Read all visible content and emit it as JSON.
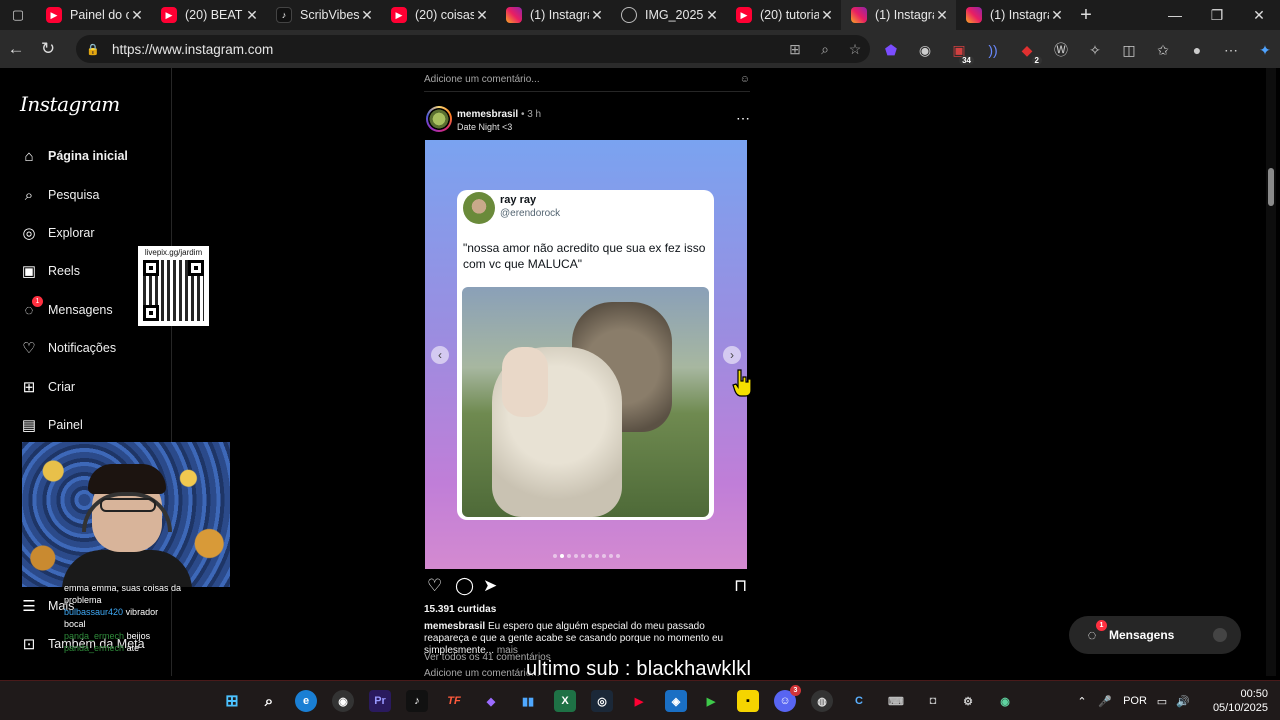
{
  "browser": {
    "tabs": [
      {
        "title": "Painel do ca",
        "favicon": "youtube-icon",
        "active": false
      },
      {
        "title": "(20) BEAT N",
        "favicon": "youtube-icon",
        "active": false
      },
      {
        "title": "ScribVibes (",
        "favicon": "tiktok-icon",
        "active": false
      },
      {
        "title": "(20) coisas c",
        "favicon": "youtube-icon",
        "active": false
      },
      {
        "title": "(1) Instagran",
        "favicon": "instagram-icon",
        "active": false
      },
      {
        "title": "IMG_20251",
        "favicon": "globe-icon",
        "active": false
      },
      {
        "title": "(20) tutorial",
        "favicon": "youtube-icon",
        "active": false
      },
      {
        "title": "(1) Instagran",
        "favicon": "instagram-icon",
        "active": true
      },
      {
        "title": "(1) Instagran",
        "favicon": "instagram-icon",
        "active": false
      }
    ],
    "url": "https://www.instagram.com",
    "extension_badges": {
      "ext2": "34",
      "ext5": "2"
    }
  },
  "instagram": {
    "logo": "Instagram",
    "nav": [
      {
        "label": "Página inicial",
        "icon": "home-icon"
      },
      {
        "label": "Pesquisa",
        "icon": "search-icon"
      },
      {
        "label": "Explorar",
        "icon": "compass-icon"
      },
      {
        "label": "Reels",
        "icon": "reels-icon"
      },
      {
        "label": "Mensagens",
        "icon": "messenger-icon",
        "badge": "1"
      },
      {
        "label": "Notificações",
        "icon": "heart-icon"
      },
      {
        "label": "Criar",
        "icon": "plus-square-icon"
      },
      {
        "label": "Painel",
        "icon": "dashboard-icon"
      }
    ],
    "more_label": "Mais",
    "meta_label": "Também da Meta",
    "prev_post_add_comment": "Adicione um comentário...",
    "post": {
      "username": "memesbrasil",
      "time": "3 h",
      "subtitle": "Date Night <3",
      "tweet": {
        "name": "ray ray",
        "handle": "@erendorock",
        "text": "\"nossa amor não acredito que sua ex fez isso com vc que MALUCA\""
      },
      "carousel_dots": 10,
      "carousel_active_index": 1,
      "likes": "15.391 curtidas",
      "caption_user": "memesbrasil",
      "caption_text": "Eu espero que alguém especial do meu passado reapareça e que a gente acabe se casando porque no momento eu simplesmente...",
      "caption_more": "mais",
      "view_comments": "Ver todos os 41 comentários",
      "add_comment": "Adicione um comentário..."
    },
    "messages_pill": {
      "label": "Mensagens",
      "badge": "1"
    }
  },
  "stream_overlay": {
    "qr_label": "livepix.gg/jardim",
    "chat": [
      {
        "user": "",
        "text": "emma emma, suas coisas da"
      },
      {
        "user": "",
        "text": "problema"
      },
      {
        "user": "bulbassaur420",
        "text": "vibrador"
      },
      {
        "user": "",
        "text": "bocal"
      },
      {
        "user": "panda_ermech",
        "text": "beijos"
      },
      {
        "user": "panda_ermech",
        "text": "ate"
      }
    ],
    "last_sub": "ultimo sub : blackhawklkl"
  },
  "taskbar": {
    "language": "POR",
    "time": "00:50",
    "date": "05/10/2025",
    "discord_badge": "3"
  },
  "colors": {
    "accent_red": "#ff3040",
    "youtube_red": "#ff0033",
    "ig_bg": "#000000",
    "taskbar_bg": "#1f1a1a"
  }
}
